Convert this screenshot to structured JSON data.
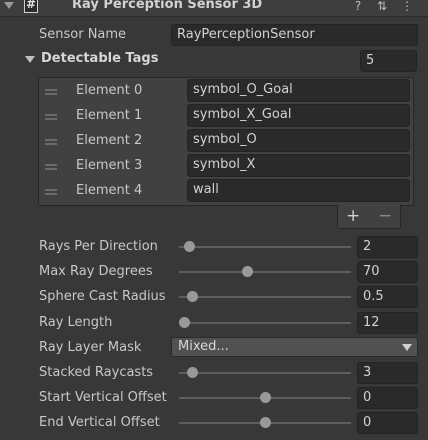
{
  "component": {
    "title": "Ray Perception Sensor 3D",
    "icons": [
      "script-icon",
      "help-icon",
      "preset-icon",
      "kebab-menu-icon"
    ]
  },
  "sensor_name": {
    "label": "Sensor Name",
    "value": "RayPerceptionSensor"
  },
  "detectable_tags": {
    "label": "Detectable Tags",
    "size": "5",
    "elements": [
      {
        "label": "Element 0",
        "value": "symbol_O_Goal"
      },
      {
        "label": "Element 1",
        "value": "symbol_X_Goal"
      },
      {
        "label": "Element 2",
        "value": "symbol_O"
      },
      {
        "label": "Element 3",
        "value": "symbol_X"
      },
      {
        "label": "Element 4",
        "value": "wall"
      }
    ],
    "add_label": "+",
    "remove_label": "−"
  },
  "properties": [
    {
      "label": "Rays Per Direction",
      "value": "2",
      "fraction": 0.03
    },
    {
      "label": "Max Ray Degrees",
      "value": "70",
      "fraction": 0.39
    },
    {
      "label": "Sphere Cast Radius",
      "value": "0.5",
      "fraction": 0.05
    },
    {
      "label": "Ray Length",
      "value": "12",
      "fraction": 0.0
    },
    {
      "label": "Stacked Raycasts",
      "value": "3",
      "fraction": 0.05
    },
    {
      "label": "Start Vertical Offset",
      "value": "0",
      "fraction": 0.5
    },
    {
      "label": "End Vertical Offset",
      "value": "0",
      "fraction": 0.5
    }
  ],
  "ray_layer_mask": {
    "label": "Ray Layer Mask",
    "value": "Mixed..."
  }
}
